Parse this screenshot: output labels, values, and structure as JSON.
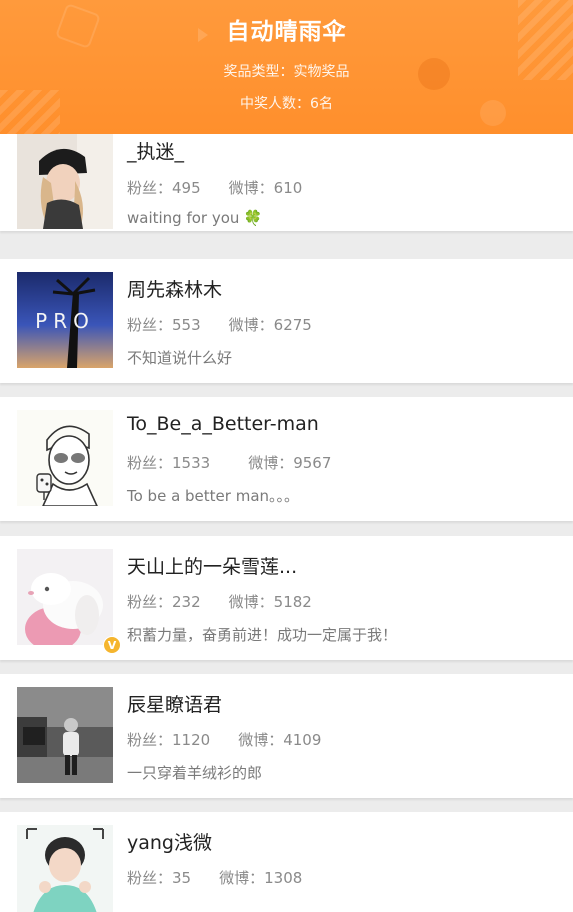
{
  "header": {
    "title": "自动晴雨伞",
    "prize_type": "奖品类型：实物奖品",
    "winner_count": "中奖人数：6名"
  },
  "labels": {
    "fans": "粉丝：",
    "weibo": "微博："
  },
  "users": [
    {
      "name": "_执迷_",
      "fans": "495",
      "weibo": "610",
      "bio": "waiting for you",
      "bio_emoji": "🍀"
    },
    {
      "name": "周先森林木",
      "fans": "553",
      "weibo": "6275",
      "bio": "不知道说什么好",
      "avatar_text": "PRO"
    },
    {
      "name": "To_Be_a_Better-man",
      "fans": "1533",
      "weibo": "9567",
      "bio": "To be a better man。。。"
    },
    {
      "name": "天山上的一朵雪莲...",
      "fans": "232",
      "weibo": "5182",
      "bio": "积蓄力量，奋勇前进！成功一定属于我！",
      "verified_badge": "V"
    },
    {
      "name": "辰星瞭语君",
      "fans": "1120",
      "weibo": "4109",
      "bio": "一只穿着羊绒衫的郎"
    },
    {
      "name": "yang浅微",
      "fans": "35",
      "weibo": "1308",
      "bio": ""
    }
  ],
  "colors": {
    "header": "#ff9430",
    "badge": "#f5b52e",
    "text_primary": "#222222",
    "text_secondary": "#8a8a8a"
  }
}
